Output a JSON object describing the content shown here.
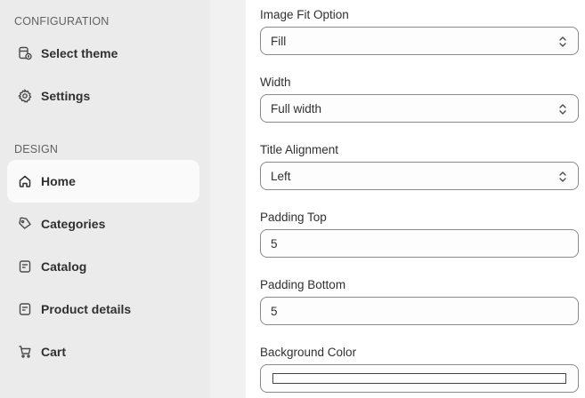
{
  "sidebar": {
    "configuration_label": "CONFIGURATION",
    "design_label": "DESIGN",
    "config_items": [
      {
        "label": "Select theme",
        "icon": "theme-icon"
      },
      {
        "label": "Settings",
        "icon": "gear-icon"
      }
    ],
    "design_items": [
      {
        "label": "Home",
        "icon": "home-icon",
        "active": true
      },
      {
        "label": "Categories",
        "icon": "tag-icon"
      },
      {
        "label": "Catalog",
        "icon": "catalog-icon"
      },
      {
        "label": "Product details",
        "icon": "product-details-icon"
      },
      {
        "label": "Cart",
        "icon": "cart-icon"
      }
    ]
  },
  "form": {
    "image_fit": {
      "label": "Image Fit Option",
      "value": "Fill"
    },
    "width": {
      "label": "Width",
      "value": "Full width"
    },
    "title_alignment": {
      "label": "Title Alignment",
      "value": "Left"
    },
    "padding_top": {
      "label": "Padding Top",
      "value": "5"
    },
    "padding_bottom": {
      "label": "Padding Bottom",
      "value": "5"
    },
    "background_color": {
      "label": "Background Color",
      "value": "#ffffff"
    }
  },
  "colors": {
    "sidebar_bg": "#ebebeb",
    "active_item_bg": "#fafafa",
    "text": "#303030",
    "border": "#8a8a8a"
  }
}
